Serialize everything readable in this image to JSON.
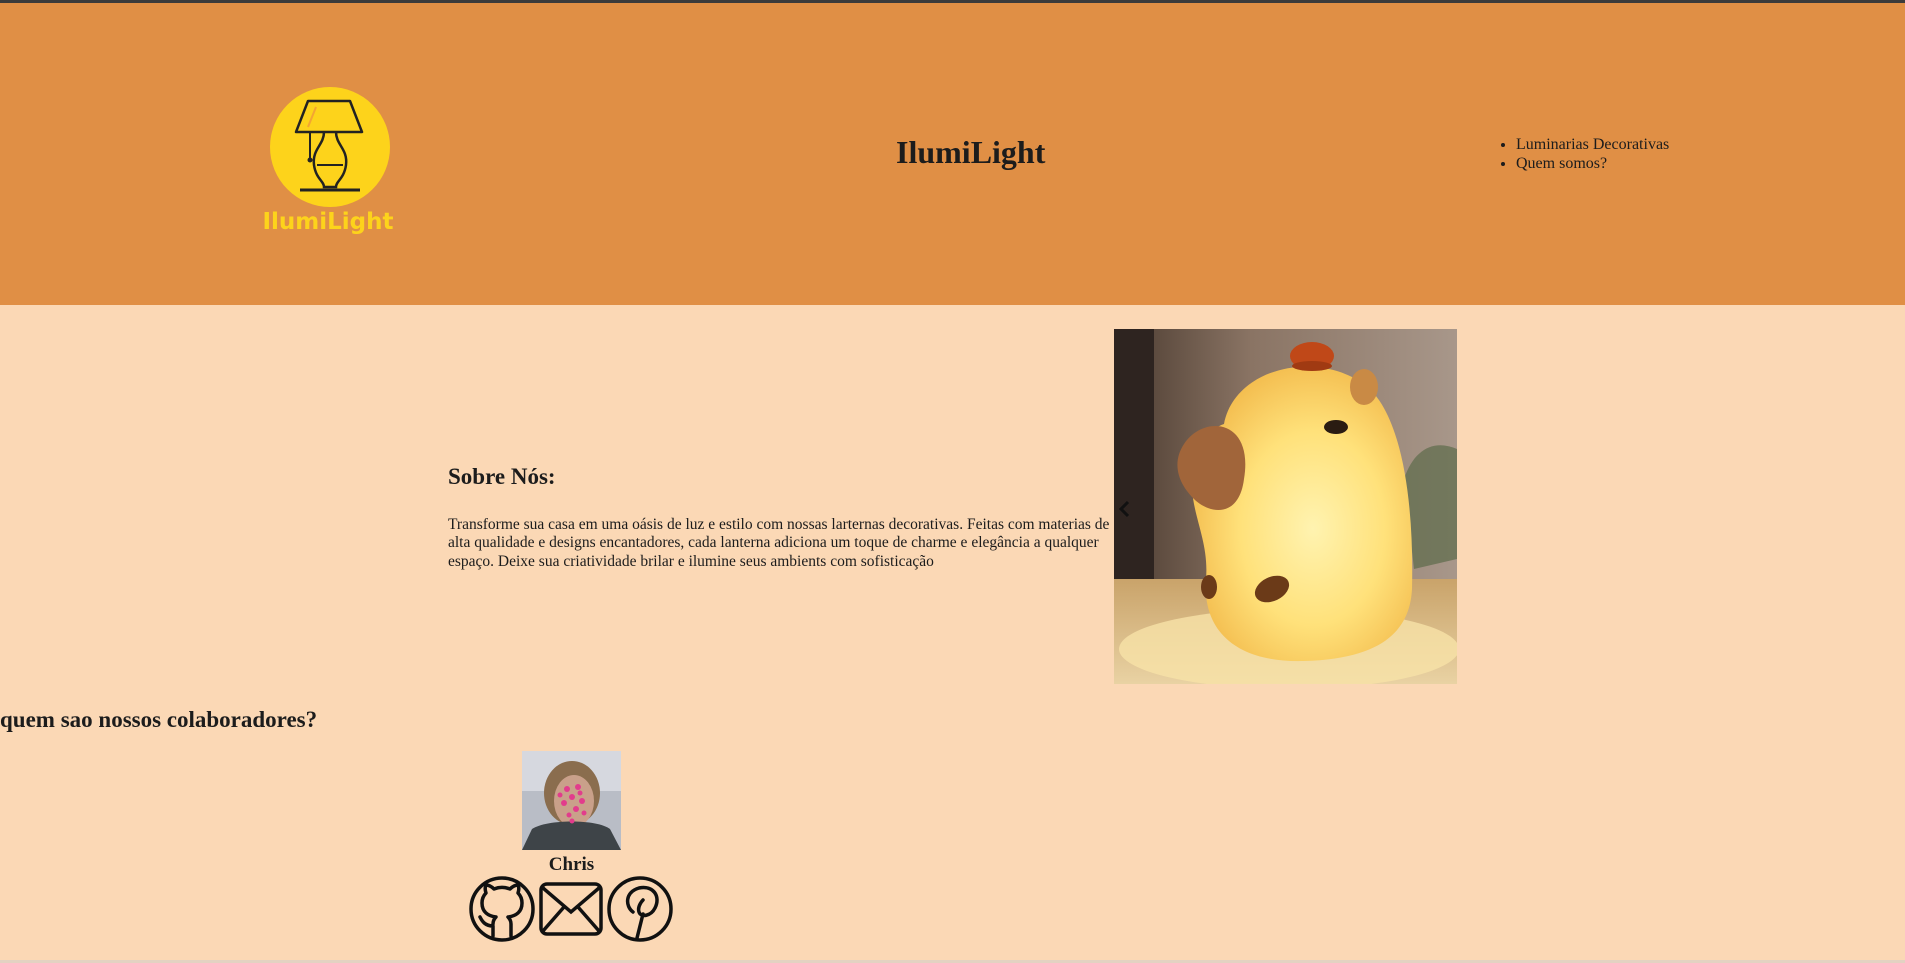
{
  "header": {
    "logo_text": "IlumiLight",
    "site_title": "IlumiLight",
    "nav": [
      {
        "label": "Luminarias Decorativas"
      },
      {
        "label": "Quem somos?"
      }
    ]
  },
  "about": {
    "title": "Sobre Nós:",
    "text": "Transforme sua casa em uma oásis de luz e estilo com nossas larternas decorativas. Feitas com materias de alta qualidade e designs encantadores, cada lanterna adiciona um toque de charme e elegância a qualquer espaço. Deixe sua criatividade brilar e ilumine seus ambients com sofisticação"
  },
  "carousel": {
    "prev_icon": "chevron-left-icon"
  },
  "collaborators": {
    "title": "quem sao nossos colaboradores?",
    "people": [
      {
        "name": "Chris",
        "socials": [
          "github-icon",
          "mail-icon",
          "pinterest-icon"
        ]
      }
    ]
  },
  "colors": {
    "header_bg": "#e08f45",
    "page_bg": "#fbd8b5",
    "logo_yellow": "#fdd31b",
    "text": "#1c1c1c"
  }
}
